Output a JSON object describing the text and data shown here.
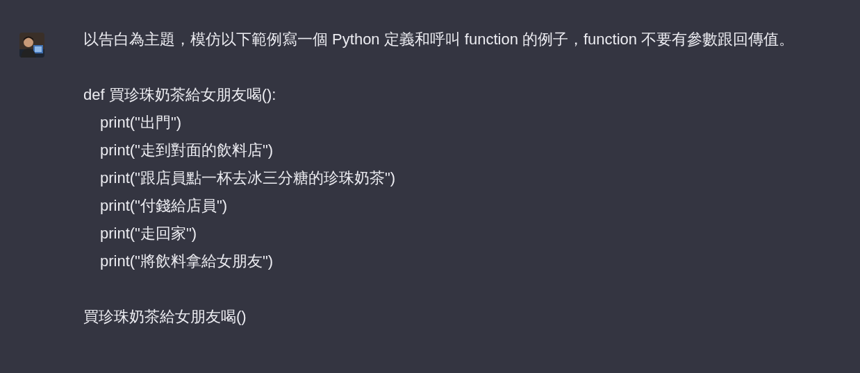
{
  "message": {
    "intro": "以告白為主題，模仿以下範例寫一個 Python 定義和呼叫 function 的例子，function 不要有參數跟回傳值。",
    "code": [
      {
        "text": "def 買珍珠奶茶給女朋友喝():",
        "children": [
          {
            "text": "print(\"出門\")"
          },
          {
            "text": "print(\"走到對面的飲料店\")"
          },
          {
            "text": "print(\"跟店員點一杯去冰三分糖的珍珠奶茶\")"
          },
          {
            "text": "print(\"付錢給店員\")"
          },
          {
            "text": "print(\"走回家\")"
          },
          {
            "text": "print(\"將飲料拿給女朋友\")"
          }
        ]
      },
      {
        "text": "買珍珠奶茶給女朋友喝()"
      }
    ]
  }
}
